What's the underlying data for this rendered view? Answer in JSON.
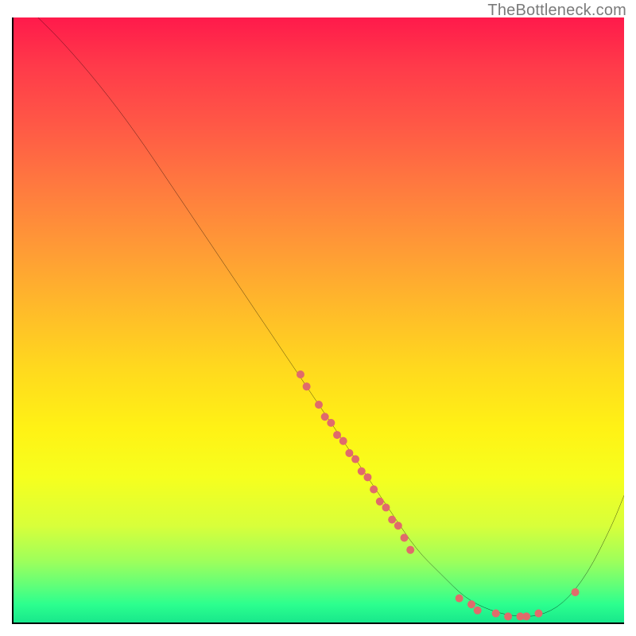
{
  "watermark": "TheBottleneck.com",
  "chart_data": {
    "type": "line",
    "title": "",
    "xlabel": "",
    "ylabel": "",
    "xlim": [
      0,
      100
    ],
    "ylim": [
      0,
      100
    ],
    "grid": false,
    "legend": false,
    "background_gradient": {
      "top": "#ff1a4b",
      "middle": "#fff215",
      "bottom": "#18e88c"
    },
    "curve": {
      "color": "#000000",
      "x": [
        4,
        8,
        14,
        20,
        26,
        32,
        38,
        44,
        50,
        54,
        58,
        62,
        66,
        70,
        74,
        78,
        82,
        86,
        90,
        94,
        98,
        100
      ],
      "y": [
        100,
        96,
        89,
        81,
        72,
        63,
        54,
        45,
        36,
        30,
        24,
        18,
        12,
        8,
        4,
        2,
        1,
        1,
        3,
        8,
        16,
        21
      ]
    },
    "marker_series": {
      "color": "#e06b6b",
      "radius": 5,
      "points": [
        {
          "x": 47,
          "y": 41
        },
        {
          "x": 48,
          "y": 39
        },
        {
          "x": 50,
          "y": 36
        },
        {
          "x": 51,
          "y": 34
        },
        {
          "x": 52,
          "y": 33
        },
        {
          "x": 53,
          "y": 31
        },
        {
          "x": 54,
          "y": 30
        },
        {
          "x": 55,
          "y": 28
        },
        {
          "x": 56,
          "y": 27
        },
        {
          "x": 57,
          "y": 25
        },
        {
          "x": 58,
          "y": 24
        },
        {
          "x": 59,
          "y": 22
        },
        {
          "x": 60,
          "y": 20
        },
        {
          "x": 61,
          "y": 19
        },
        {
          "x": 62,
          "y": 17
        },
        {
          "x": 63,
          "y": 16
        },
        {
          "x": 64,
          "y": 14
        },
        {
          "x": 65,
          "y": 12
        },
        {
          "x": 73,
          "y": 4
        },
        {
          "x": 75,
          "y": 3
        },
        {
          "x": 76,
          "y": 2
        },
        {
          "x": 79,
          "y": 1.5
        },
        {
          "x": 81,
          "y": 1
        },
        {
          "x": 83,
          "y": 1
        },
        {
          "x": 84,
          "y": 1
        },
        {
          "x": 86,
          "y": 1.5
        },
        {
          "x": 92,
          "y": 5
        }
      ]
    }
  }
}
